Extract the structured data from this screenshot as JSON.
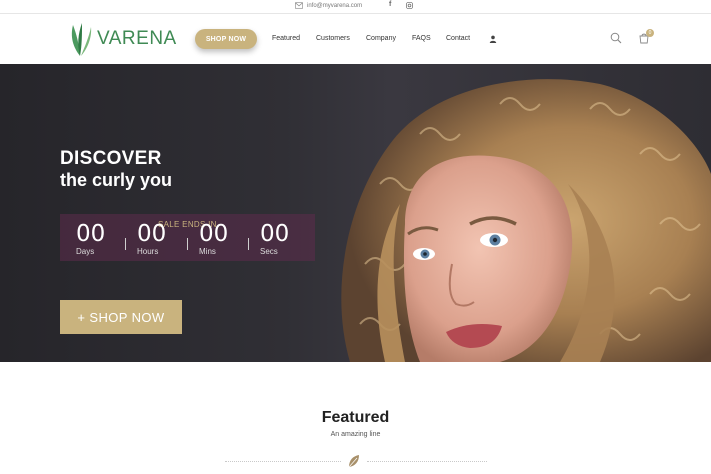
{
  "topbar": {
    "email": "info@myvarena.com",
    "facebook_icon": "f",
    "icons": [
      "mail-icon",
      "facebook-icon",
      "instagram-icon"
    ]
  },
  "header": {
    "logo_text": "VARENA",
    "shop_button": "SHOP NOW",
    "nav": [
      "Featured",
      "Customers",
      "Company",
      "FAQS",
      "Contact"
    ],
    "cart_count": "0",
    "icons": [
      "user-icon",
      "search-icon",
      "cart-icon"
    ]
  },
  "hero": {
    "title": "DISCOVER",
    "subtitle": "the curly you",
    "sale_label": "SALE ENDS IN",
    "countdown": [
      {
        "value": "00",
        "label": "Days"
      },
      {
        "value": "00",
        "label": "Hours"
      },
      {
        "value": "00",
        "label": "Mins"
      },
      {
        "value": "00",
        "label": "Secs"
      }
    ],
    "cta": "+ SHOP NOW"
  },
  "featured": {
    "title": "Featured",
    "subtitle": "An amazing line"
  },
  "colors": {
    "accent_gold": "#c9b37e",
    "brand_green": "#3f8a54",
    "countdown_bg": "#5c2c4c"
  }
}
